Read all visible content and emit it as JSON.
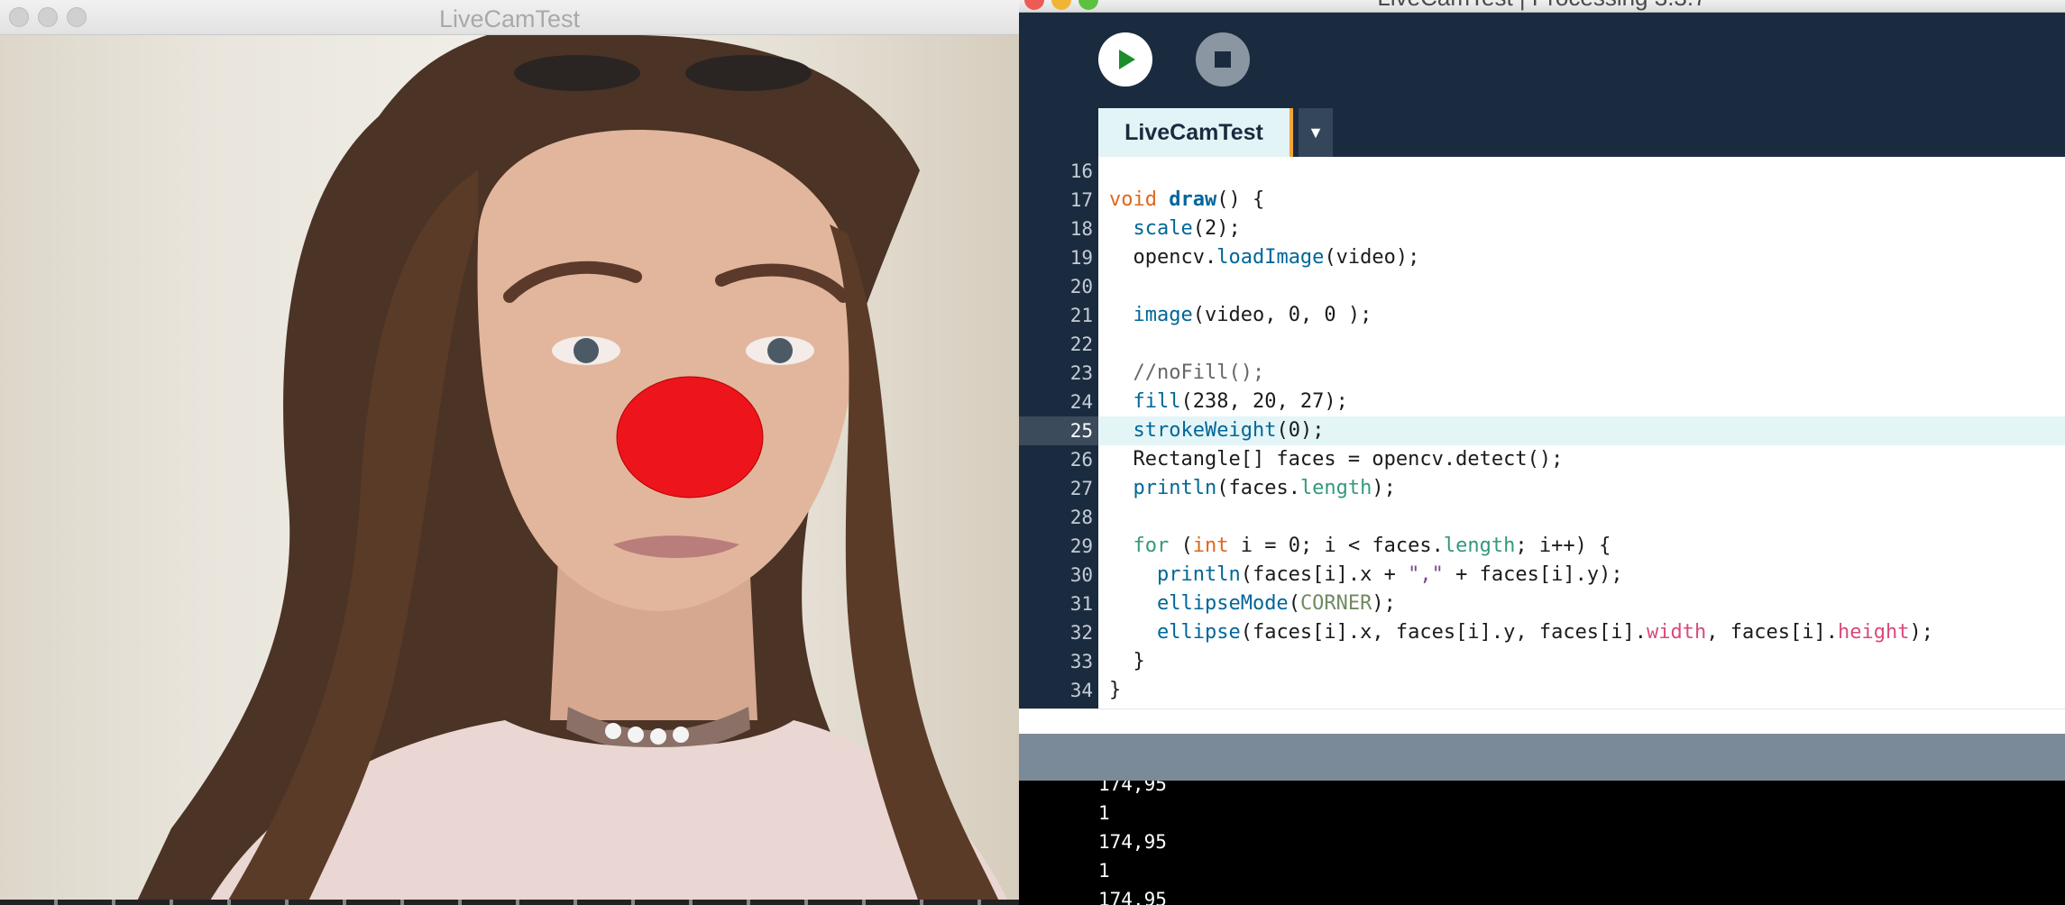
{
  "sketch_window": {
    "title": "LiveCamTest",
    "detected_fill_color": "#ee141b"
  },
  "ide_window": {
    "title": "LiveCamTest | Processing 3.3.7",
    "toolbar": {
      "run_icon": "play-icon",
      "stop_icon": "stop-icon"
    },
    "tabs": [
      {
        "label": "LiveCamTest"
      }
    ],
    "tab_menu_icon": "▼",
    "current_line": 25,
    "code_lines": [
      {
        "n": "16",
        "text": ""
      },
      {
        "n": "17",
        "text": "void draw() {"
      },
      {
        "n": "18",
        "text": "  scale(2);"
      },
      {
        "n": "19",
        "text": "  opencv.loadImage(video);"
      },
      {
        "n": "20",
        "text": ""
      },
      {
        "n": "21",
        "text": "  image(video, 0, 0 );"
      },
      {
        "n": "22",
        "text": ""
      },
      {
        "n": "23",
        "text": "  //noFill();"
      },
      {
        "n": "24",
        "text": "  fill(238, 20, 27);"
      },
      {
        "n": "25",
        "text": "  strokeWeight(0);"
      },
      {
        "n": "26",
        "text": "  Rectangle[] faces = opencv.detect();"
      },
      {
        "n": "27",
        "text": "  println(faces.length);"
      },
      {
        "n": "28",
        "text": ""
      },
      {
        "n": "29",
        "text": "  for (int i = 0; i < faces.length; i++) {"
      },
      {
        "n": "30",
        "text": "    println(faces[i].x + \",\" + faces[i].y);"
      },
      {
        "n": "31",
        "text": "    ellipseMode(CORNER);"
      },
      {
        "n": "32",
        "text": "    ellipse(faces[i].x, faces[i].y, faces[i].width, faces[i].height);"
      },
      {
        "n": "33",
        "text": "  }"
      },
      {
        "n": "34",
        "text": "}"
      }
    ],
    "console_lines": [
      "174,95",
      "1",
      "174,95",
      "1",
      "174,95"
    ]
  }
}
